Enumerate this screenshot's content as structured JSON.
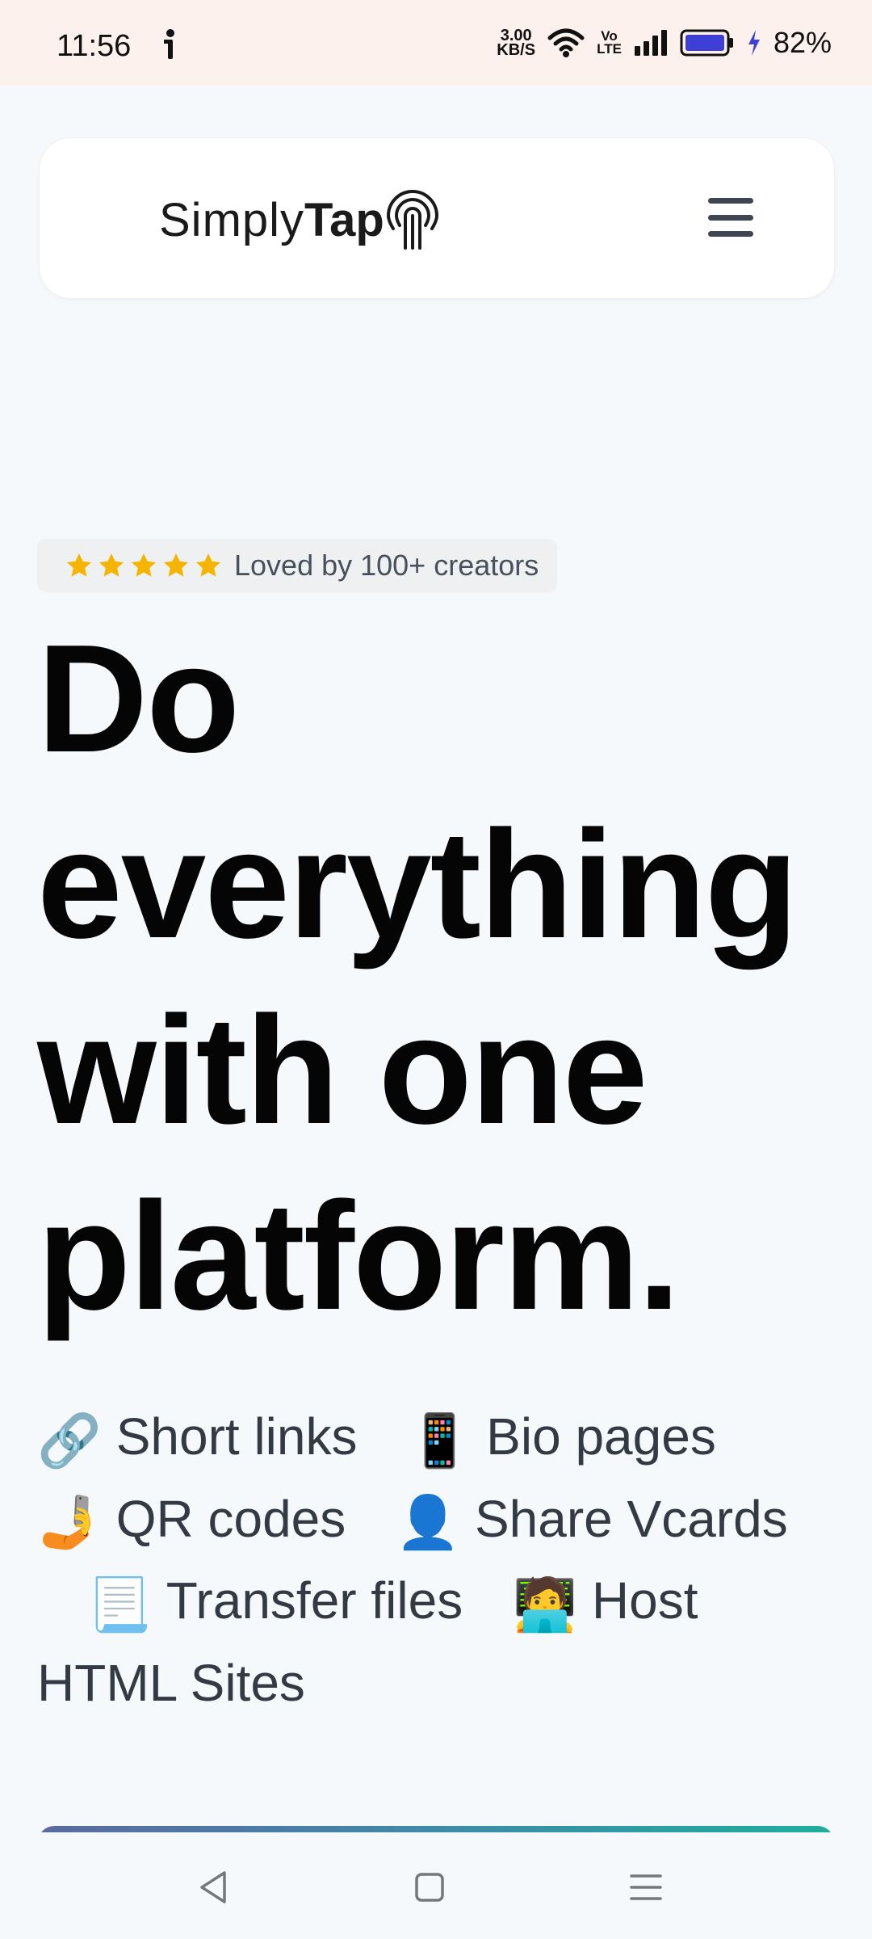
{
  "status_bar": {
    "time": "11:56",
    "net_speed_value": "3.00",
    "net_speed_unit": "KB/S",
    "volte_top": "Vo",
    "volte_bottom": "LTE",
    "battery_percent": "82%",
    "icons": [
      "alert-icon",
      "wifi-icon",
      "volte-icon",
      "signal-icon",
      "battery-icon",
      "charging-icon"
    ]
  },
  "header": {
    "logo_light": "Simply",
    "logo_bold": "Tap",
    "menu_icon": "hamburger-menu-icon"
  },
  "badge": {
    "stars": 5,
    "text": "Loved by 100+ creators",
    "star_color": "#f5b400"
  },
  "hero": {
    "line1": "Do",
    "line2": "everything",
    "line3": "with one",
    "line4": "platform."
  },
  "features": [
    {
      "emoji": "🔗",
      "label": "Short links"
    },
    {
      "emoji": "📱",
      "label": "Bio pages"
    },
    {
      "emoji": "🤳",
      "label": "QR codes"
    },
    {
      "emoji": "👤",
      "label": "Share Vcards"
    },
    {
      "emoji": "📃",
      "label": "Transfer files"
    },
    {
      "emoji": "🧑‍💻",
      "label": "Host"
    },
    {
      "label": "HTML Sites"
    }
  ],
  "nav": {
    "back_icon": "back-triangle-icon",
    "home_icon": "home-square-icon",
    "menu_icon": "recents-menu-icon"
  },
  "colors": {
    "background": "#f5f9fc",
    "status_bar_bg": "#fdf1ee",
    "headline": "#050505",
    "body_text": "#333a44",
    "gradient_start": "#5b6aa2",
    "gradient_end": "#1fae9c"
  }
}
